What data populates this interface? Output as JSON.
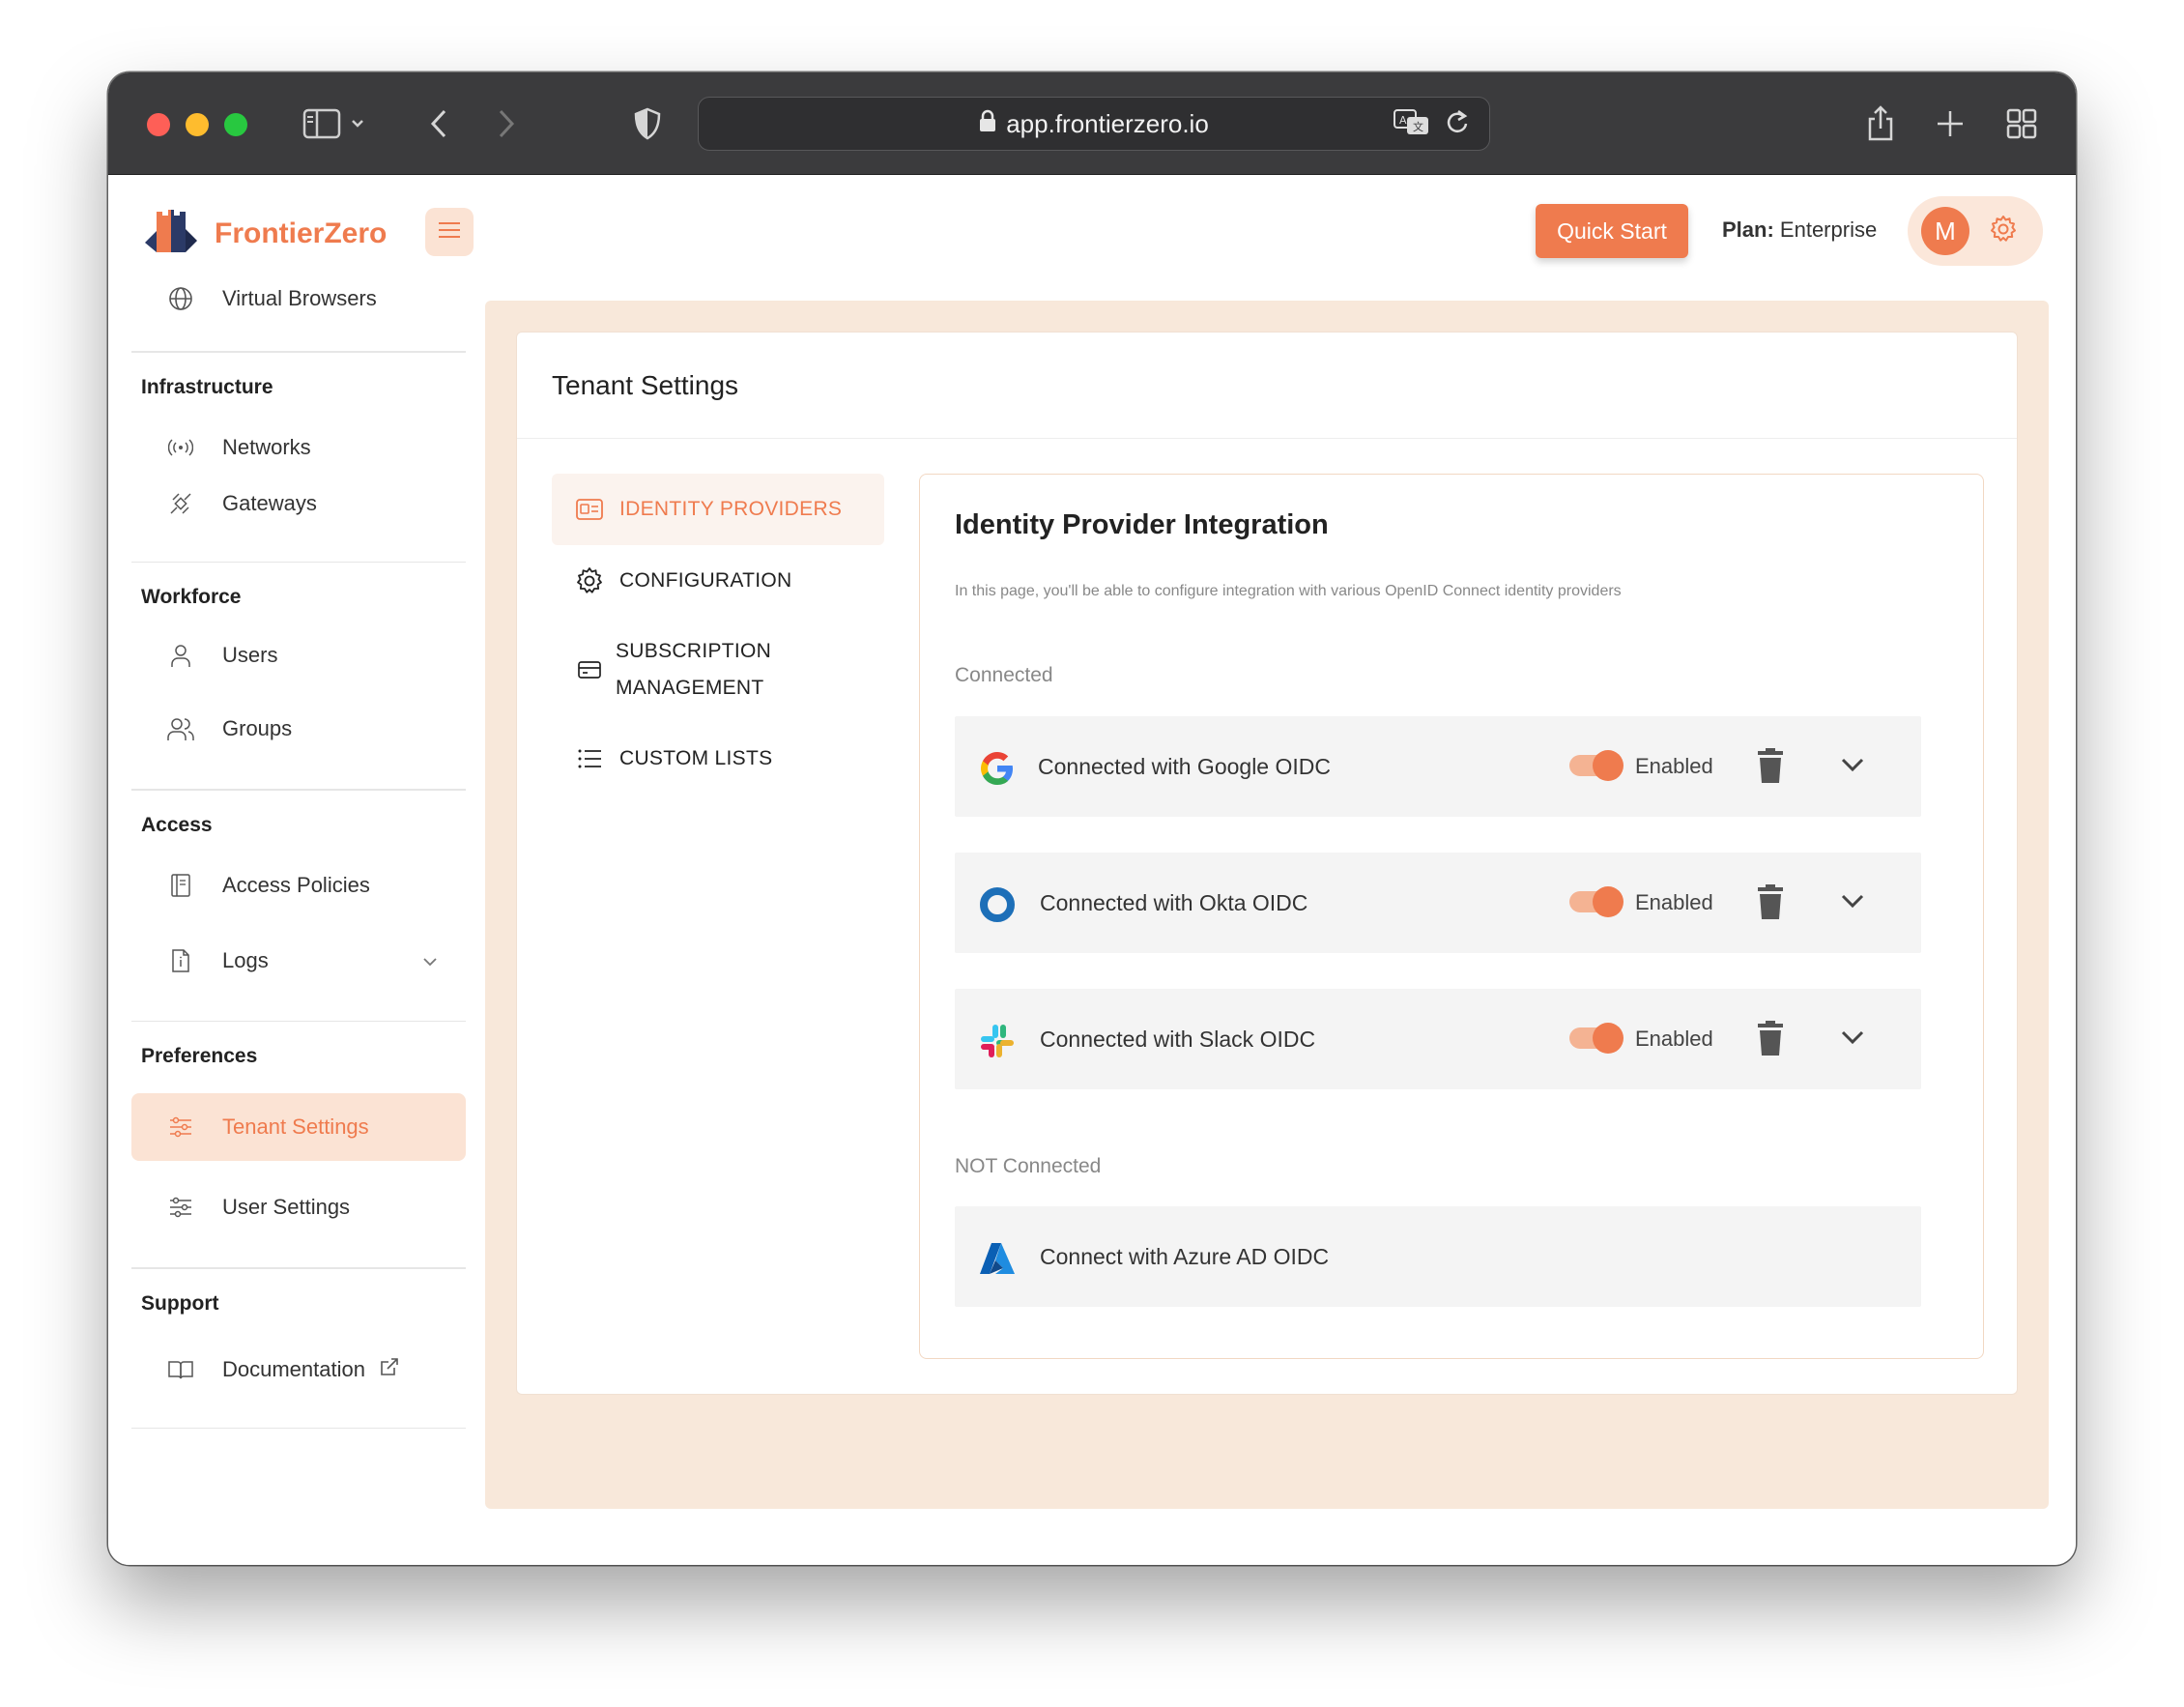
{
  "browser": {
    "url": "app.frontierzero.io"
  },
  "app": {
    "brand": "FrontierZero",
    "quick_start": "Quick Start",
    "plan_label": "Plan:",
    "plan_value": "Enterprise",
    "avatar_initial": "M"
  },
  "sidebar": {
    "top_item": "Virtual Browsers",
    "sections": [
      {
        "title": "Infrastructure",
        "items": [
          "Networks",
          "Gateways"
        ]
      },
      {
        "title": "Workforce",
        "items": [
          "Users",
          "Groups"
        ]
      },
      {
        "title": "Access",
        "items": [
          "Access Policies",
          "Logs"
        ]
      },
      {
        "title": "Preferences",
        "items": [
          "Tenant Settings",
          "User Settings"
        ]
      },
      {
        "title": "Support",
        "items": [
          "Documentation"
        ]
      }
    ]
  },
  "page": {
    "title": "Tenant Settings",
    "tabs": [
      "IDENTITY PROVIDERS",
      "CONFIGURATION",
      "SUBSCRIPTION",
      "MANAGEMENT",
      "CUSTOM LISTS"
    ],
    "panel_title": "Identity Provider Integration",
    "panel_desc": "In this page, you'll be able to configure integration with various OpenID Connect identity providers",
    "connected_label": "Connected",
    "not_connected_label": "NOT Connected",
    "providers": [
      {
        "name": "Connected with Google OIDC",
        "status": "Enabled",
        "enabled": true
      },
      {
        "name": "Connected with Okta OIDC",
        "status": "Enabled",
        "enabled": true
      },
      {
        "name": "Connected with Slack OIDC",
        "status": "Enabled",
        "enabled": true
      }
    ],
    "not_connected": [
      {
        "name": "Connect with Azure AD OIDC"
      }
    ]
  },
  "colors": {
    "accent": "#ef7b4e",
    "accent_light": "#fbe3d4",
    "content_bg": "#f8e8da"
  }
}
